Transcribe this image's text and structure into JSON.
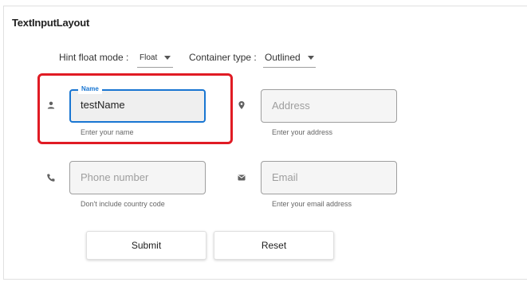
{
  "card": {
    "title": "TextInputLayout"
  },
  "options": {
    "hint_float_mode": {
      "label": "Hint float mode :",
      "value": "Float"
    },
    "container_type": {
      "label": "Container type :",
      "value": "Outlined"
    }
  },
  "fields": {
    "name": {
      "label": "Name",
      "value": "testName",
      "hint": "Enter your name",
      "icon": "person-icon"
    },
    "address": {
      "placeholder": "Address",
      "hint": "Enter your address",
      "icon": "location-pin-icon"
    },
    "phone": {
      "placeholder": "Phone number",
      "hint": "Don't include country code",
      "icon": "phone-icon"
    },
    "email": {
      "placeholder": "Email",
      "hint": "Enter your email address",
      "icon": "mail-icon"
    }
  },
  "buttons": {
    "submit": "Submit",
    "reset": "Reset"
  },
  "colors": {
    "accent": "#1976d2",
    "highlight": "#e01b24"
  }
}
